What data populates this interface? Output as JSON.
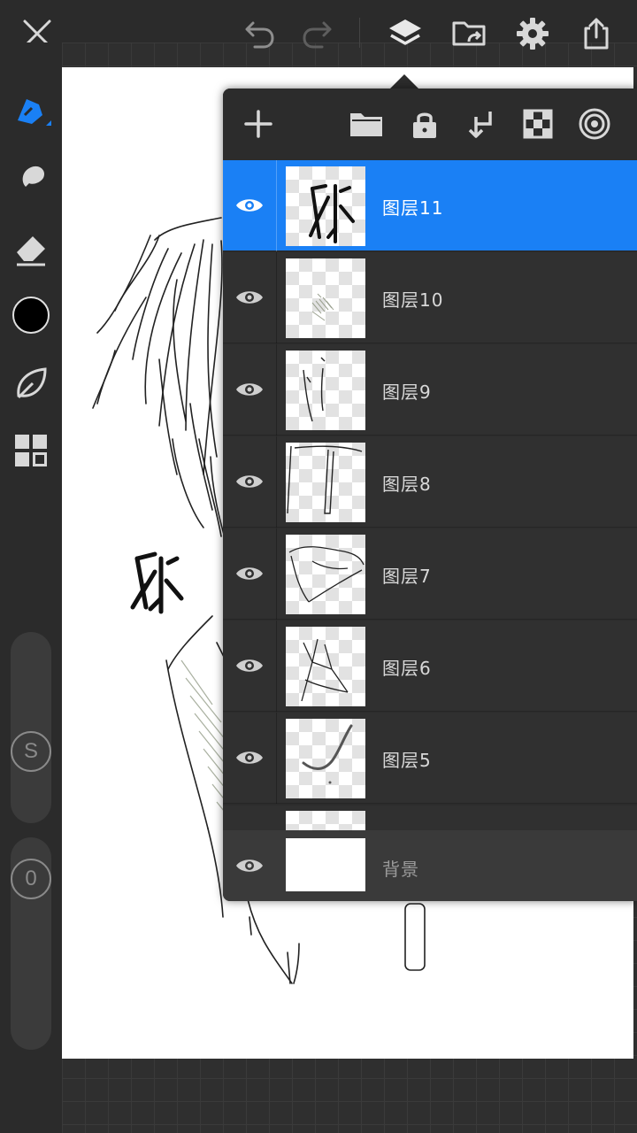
{
  "colors": {
    "accent": "#1a80f5",
    "toolbar_bg": "#2b2b2b",
    "panel_bg": "#2c2c2c",
    "icon": "#d8d8d8",
    "current_color": "#000000"
  },
  "topbar": {
    "icons": [
      "close-icon",
      "undo-icon",
      "redo-icon",
      "layers-icon",
      "gallery-import-icon",
      "gear-icon",
      "share-icon"
    ]
  },
  "left_toolbar": {
    "icons": [
      "brush-tool-icon",
      "smudge-tool-icon",
      "eraser-tool-icon",
      "color-swatch",
      "leaf-icon",
      "grid-icon"
    ],
    "size_slider_label": "S",
    "opacity_slider_label": "0"
  },
  "layers_panel": {
    "header_icons": [
      "add-layer-icon",
      "folder-icon",
      "lock-icon",
      "merge-down-icon",
      "transparency-icon",
      "radial-icon"
    ],
    "layers": [
      {
        "name": "图层11",
        "selected": true,
        "visible": true
      },
      {
        "name": "图层10",
        "selected": false,
        "visible": true
      },
      {
        "name": "图层9",
        "selected": false,
        "visible": true
      },
      {
        "name": "图层8",
        "selected": false,
        "visible": true
      },
      {
        "name": "图层7",
        "selected": false,
        "visible": true
      },
      {
        "name": "图层6",
        "selected": false,
        "visible": true
      },
      {
        "name": "图层5",
        "selected": false,
        "visible": true
      }
    ],
    "background_layer": {
      "name": "背景",
      "visible": true
    }
  }
}
